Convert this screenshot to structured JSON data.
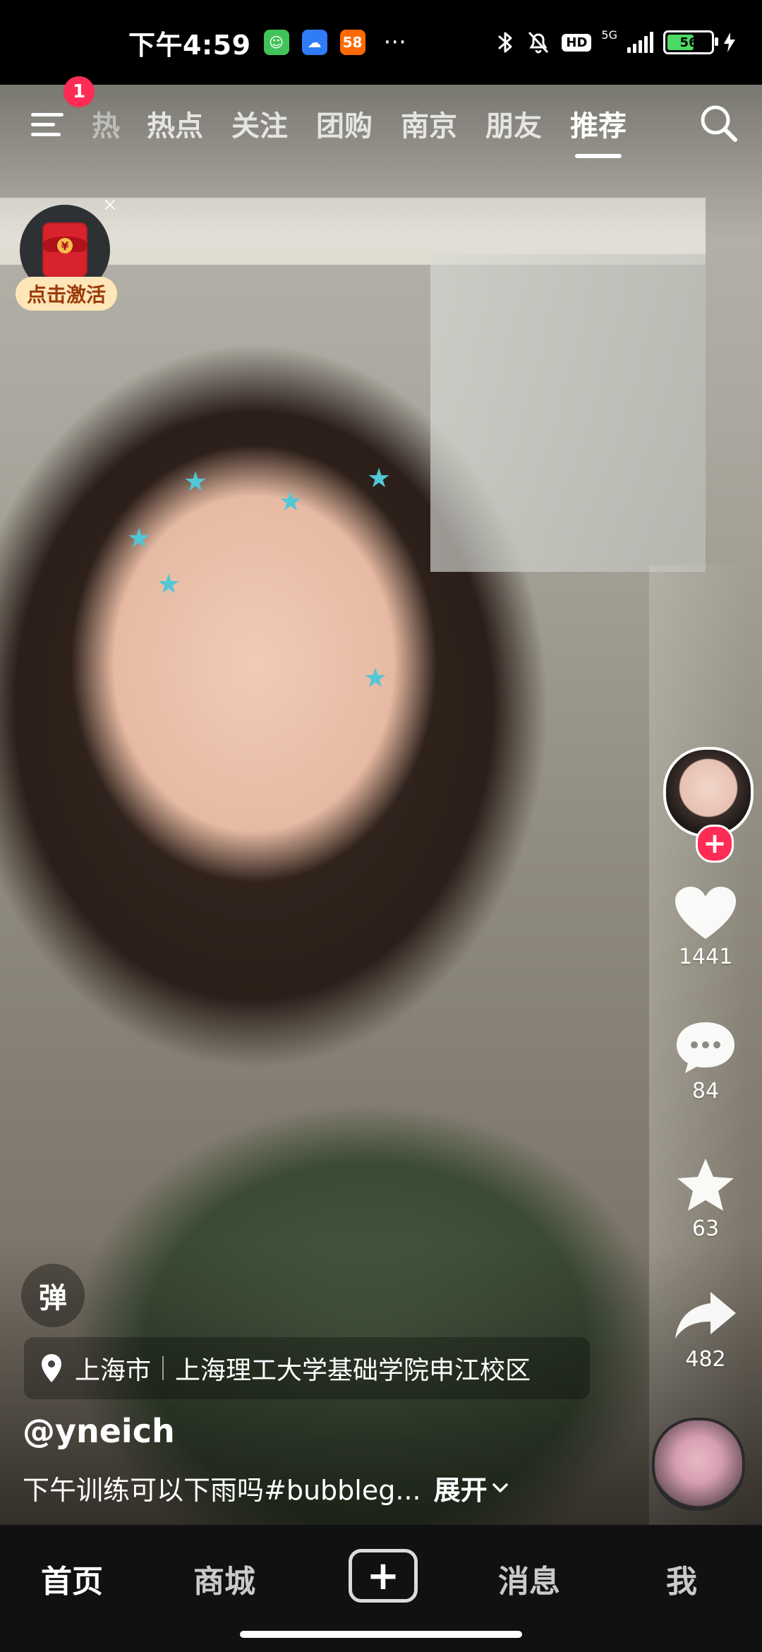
{
  "status_bar": {
    "time": "下午4:59",
    "app_icons": [
      "wechat-like-icon",
      "cloud-icon",
      "58-icon"
    ],
    "more": "···",
    "hd": "HD",
    "network": "5G",
    "battery": "56"
  },
  "top_nav": {
    "badge_count": "1",
    "tabs": [
      {
        "label": "热",
        "partial": true
      },
      {
        "label": "热点"
      },
      {
        "label": "关注"
      },
      {
        "label": "团购"
      },
      {
        "label": "南京"
      },
      {
        "label": "朋友"
      },
      {
        "label": "推荐",
        "active": true
      }
    ]
  },
  "promo": {
    "label": "点击激活",
    "close": "×"
  },
  "actions": {
    "likes": "1441",
    "comments": "84",
    "favorites": "63",
    "shares": "482"
  },
  "danmu": "弹",
  "location": {
    "city": "上海市",
    "place": "上海理工大学基础学院申江校区"
  },
  "post": {
    "username": "@yneich",
    "caption": "下午训练可以下雨吗#bubbleg...",
    "expand": "展开"
  },
  "bottom_nav": {
    "home": "首页",
    "mall": "商城",
    "create": "+",
    "messages": "消息",
    "me": "我"
  }
}
